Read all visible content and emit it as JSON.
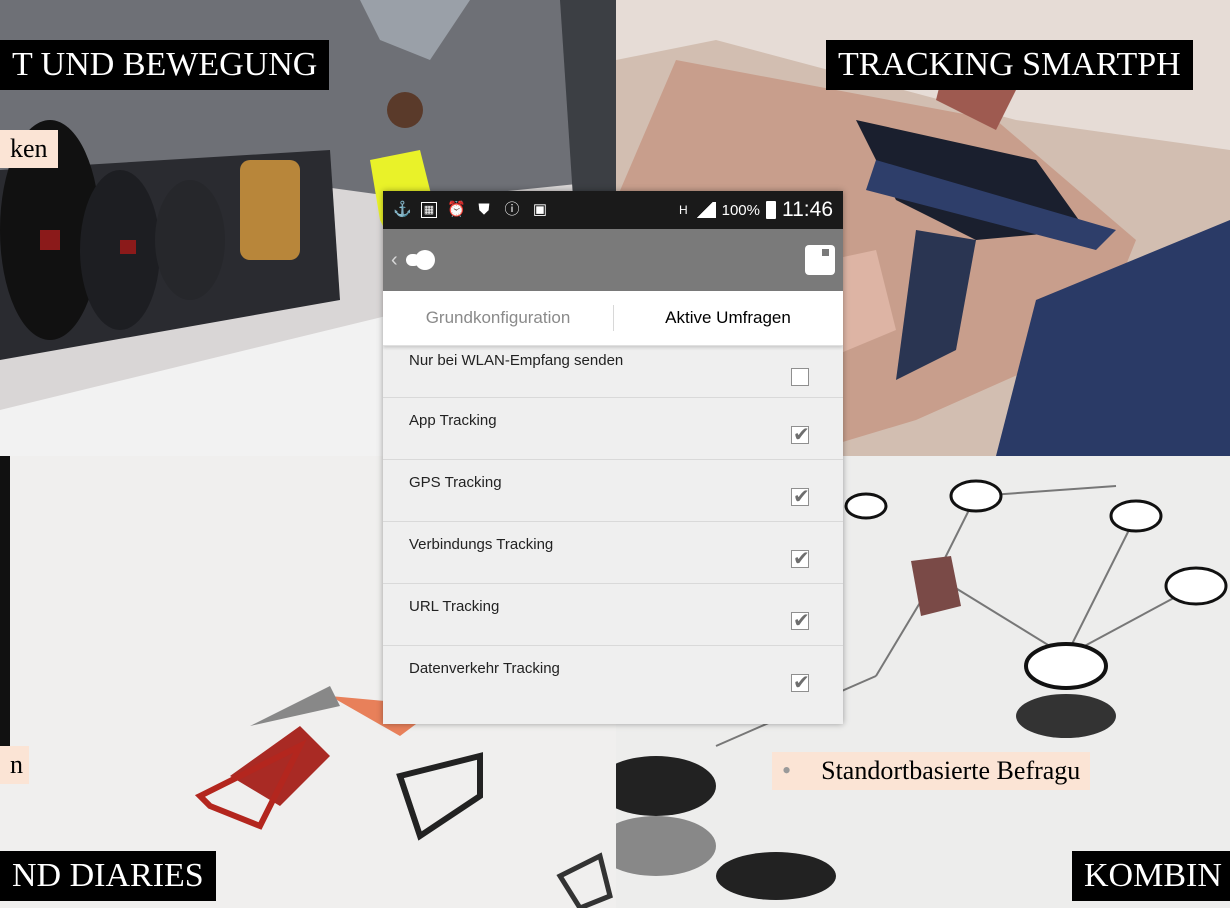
{
  "slide": {
    "title_tl": "T UND BEWEGUNG",
    "title_tr": "TRACKING SMARTPH",
    "title_bl": "ND DIARIES",
    "title_br": "KOMBIN",
    "note_tl": "ken",
    "note_bl": "n",
    "note_br": "Standortbasierte Befragu",
    "bullet": "•"
  },
  "phone": {
    "status": {
      "icons": [
        "usb-icon",
        "sd-card-icon",
        "alarm-icon",
        "shield-icon",
        "info-icon",
        "image-icon"
      ],
      "network": "H",
      "battery_pct": "100%",
      "time": "11:46"
    },
    "appbar": {
      "back_glyph": "‹"
    },
    "tabs": [
      {
        "label": "Grundkonfiguration",
        "active": false
      },
      {
        "label": "Aktive Umfragen",
        "active": true
      }
    ],
    "settings": [
      {
        "label": "Nur bei WLAN-Empfang senden",
        "checked": false
      },
      {
        "label": "App Tracking",
        "checked": true
      },
      {
        "label": "GPS Tracking",
        "checked": true
      },
      {
        "label": "Verbindungs Tracking",
        "checked": true
      },
      {
        "label": "URL Tracking",
        "checked": true
      },
      {
        "label": "Datenverkehr Tracking",
        "checked": true
      }
    ]
  },
  "colors": {
    "appbar": "#7a7a7a",
    "statusbar": "#1a1a1a",
    "note_bg": "#fbe4d5"
  }
}
